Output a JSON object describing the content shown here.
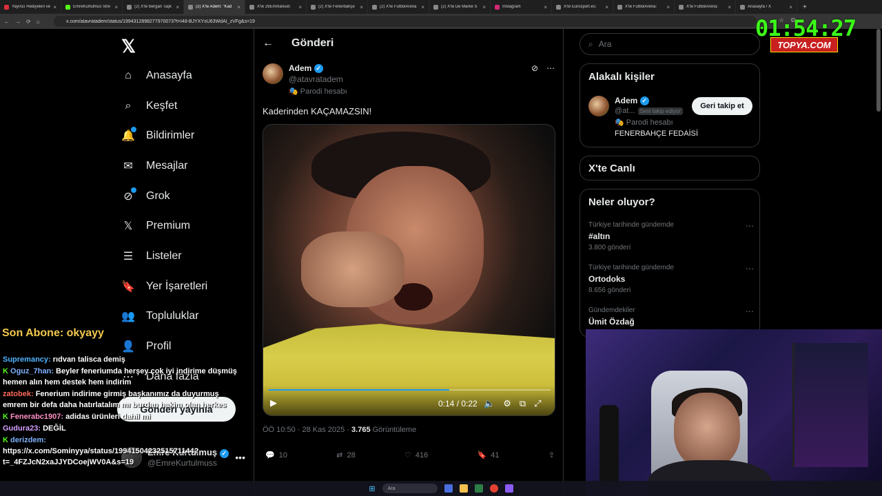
{
  "browser": {
    "tabs": [
      {
        "title": "Yayıncı Hediyeleri ve",
        "color": "#e0303a"
      },
      {
        "title": "EmreKurtulmus Stre",
        "color": "#53fc18"
      },
      {
        "title": "(2) X'te Bergan Taşk",
        "color": "#888888"
      },
      {
        "title": "(2) X'te Adem: \"Kad",
        "color": "#888888"
      },
      {
        "title": "X'te 29Emmanuel: ",
        "color": "#888888"
      },
      {
        "title": "(2) X'te Fenerbahçe",
        "color": "#888888"
      },
      {
        "title": "(2) X'te FutbolArena",
        "color": "#888888"
      },
      {
        "title": "(2) X'te De Marke S",
        "color": "#888888"
      },
      {
        "title": "Instagram",
        "color": "#d62976"
      },
      {
        "title": "X'te Eurosport.es: ",
        "color": "#888888"
      },
      {
        "title": "X'te FutbolArena: ",
        "color": "#888888"
      },
      {
        "title": "X'te FutbolArena: ",
        "color": "#888888"
      },
      {
        "title": "Anasayfa / X",
        "color": "#888888"
      }
    ],
    "active_tab": 3,
    "url": "x.com/atavratadem/status/1994312898277970073?t=I48-BJYXYsU63WdAI_zVFg&s=19"
  },
  "overlay": {
    "clock": "01:54:27",
    "brand": "TOPYA.COM",
    "sub_banner": "Son Abone: okyayy",
    "chat": [
      {
        "user": "Supremancy:",
        "text": "rıdvan talisca demiş",
        "color": "#4fb3ff",
        "badge": ""
      },
      {
        "user": "Oguz_7han:",
        "text": "Beyler feneriumda herşey çok iyi indirime düşmüş hemen alın hem destek hem indirim",
        "color": "#7fb2ff",
        "badge": "K"
      },
      {
        "user": "zatobek:",
        "text": "Fenerium indirime girmiş başkanımız da duyurmuş emrem bir defa daha hatırlatalım mı burdan hakim olan herkes",
        "color": "#ff6a5c",
        "badge": ""
      },
      {
        "user": "Fenerabc1907:",
        "text": "adidas ürünleri dahil mi",
        "color": "#ff8ec4",
        "badge": "K"
      },
      {
        "user": "Gudura23:",
        "text": "DEĞİL",
        "color": "#d7a0ff",
        "badge": ""
      },
      {
        "user": "derizdem:",
        "text": "https://x.com/Sominyya/status/1994150423251571144?t=_4FZJcN2xaJJYDCoejWV0A&s=19",
        "color": "#7fb2ff",
        "badge": "K"
      }
    ]
  },
  "left_nav": {
    "items": [
      {
        "label": "Anasayfa",
        "icon": "home-icon",
        "glyph": "⌂"
      },
      {
        "label": "Keşfet",
        "icon": "search-icon",
        "glyph": "⌕"
      },
      {
        "label": "Bildirimler",
        "icon": "bell-icon",
        "glyph": "🔔"
      },
      {
        "label": "Mesajlar",
        "icon": "mail-icon",
        "glyph": "✉"
      },
      {
        "label": "Grok",
        "icon": "grok-icon",
        "glyph": "⊘"
      },
      {
        "label": "Premium",
        "icon": "x-premium-icon",
        "glyph": "𝕏"
      },
      {
        "label": "Listeler",
        "icon": "list-icon",
        "glyph": "☰"
      },
      {
        "label": "Yer İşaretleri",
        "icon": "bookmark-icon",
        "glyph": "🔖"
      },
      {
        "label": "Topluluklar",
        "icon": "community-icon",
        "glyph": "👥"
      },
      {
        "label": "Profil",
        "icon": "profile-icon",
        "glyph": "👤"
      },
      {
        "label": "Daha fazla",
        "icon": "more-circle-icon",
        "glyph": "⋯"
      }
    ],
    "post_button": "Gönderi yayınla",
    "account": {
      "name": "Emre Kurtulmuş",
      "handle": "@EmreKurtulmuss"
    }
  },
  "tweet": {
    "header_title": "Gönderi",
    "author_name": "Adem",
    "author_handle": "@atavratadem",
    "parody": "Parodi hesabı",
    "text": "Kaderinden KAÇAMAZSIN!",
    "video_time": "0:14 / 0:22",
    "video_progress": 0.64,
    "timestamp": "ÖÖ 10:50 · 28 Kas 2025 · ",
    "views": "3.765",
    "views_label": " Görüntüleme",
    "replies": "10",
    "reposts": "28",
    "likes": "416",
    "bookmarks": "41"
  },
  "right": {
    "search_placeholder": "Ara",
    "related_title": "Alakalı kişiler",
    "related_user": {
      "name": "Adem",
      "handle": "@at...",
      "chip": "Seni takip ediyor",
      "parody": "Parodi hesabı",
      "bio": "FENERBAHÇE FEDAİSİ",
      "button": "Geri takip et"
    },
    "live_title": "X'te Canlı",
    "trends_title": "Neler oluyor?",
    "trends": [
      {
        "category": "Türkiye tarihinde gündemde",
        "name": "#altın",
        "count": "3.800 gönderi"
      },
      {
        "category": "Türkiye tarihinde gündemde",
        "name": "Ortodoks",
        "count": "8.656 gönderi"
      },
      {
        "category": "Gündemdekiler",
        "name": "Ümit Özdağ",
        "count": ""
      }
    ]
  },
  "taskbar": {
    "search": "Ara"
  }
}
